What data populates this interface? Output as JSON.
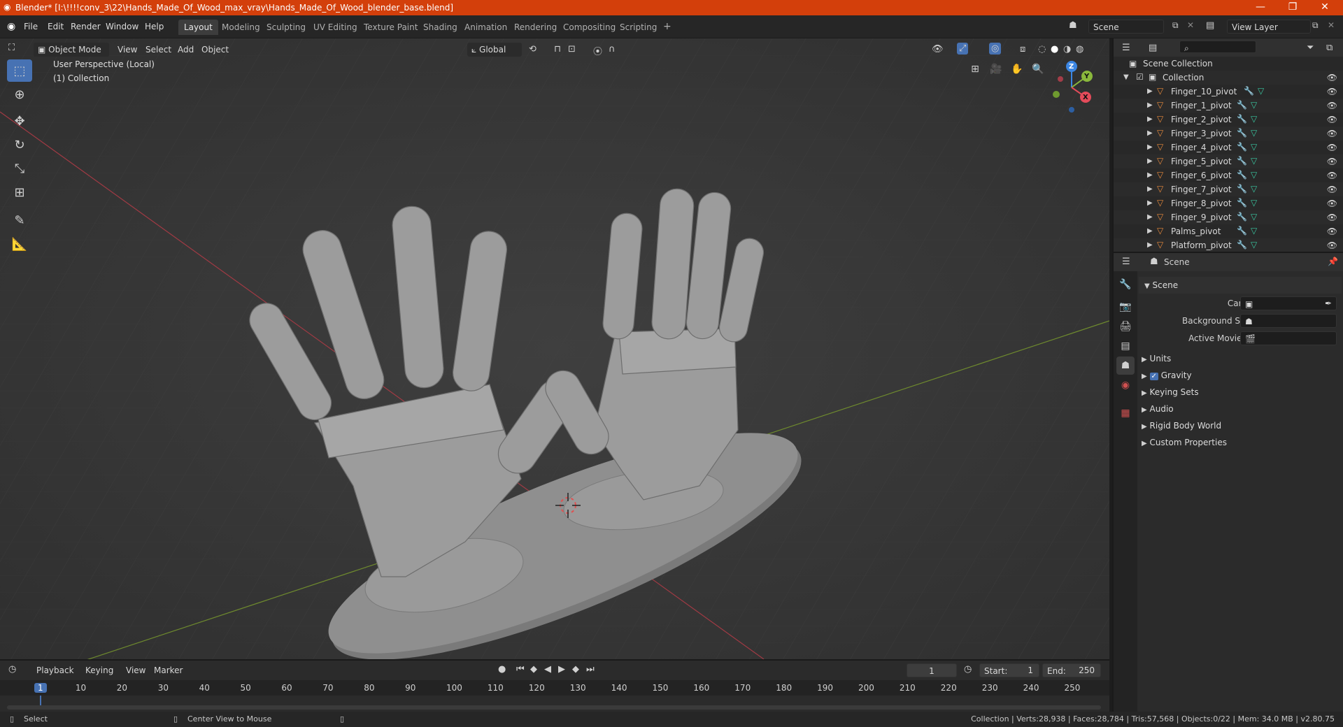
{
  "window": {
    "title": "Blender* [I:\\!!!!conv_3\\22\\Hands_Made_Of_Wood_max_vray\\Hands_Made_Of_Wood_blender_base.blend]",
    "minimize_icon": "minimize-icon",
    "maximize_icon": "restore-icon",
    "close_icon": "close-icon"
  },
  "topbar": {
    "menus": [
      "File",
      "Edit",
      "Render",
      "Window",
      "Help"
    ],
    "workspaces": [
      "Layout",
      "Modeling",
      "Sculpting",
      "UV Editing",
      "Texture Paint",
      "Shading",
      "Animation",
      "Rendering",
      "Compositing",
      "Scripting"
    ],
    "active_workspace": "Layout",
    "add_workspace": "+",
    "scene_value": "Scene",
    "view_layer_value": "View Layer"
  },
  "viewport": {
    "mode": "Object Mode",
    "menus": [
      "View",
      "Select",
      "Add",
      "Object"
    ],
    "transform_orientation": "Global",
    "overlay_line1": "User Perspective (Local)",
    "overlay_line2": "(1) Collection",
    "gizmo": {
      "x": "X",
      "y": "Y",
      "z": "Z"
    },
    "colors": {
      "x_axis": "#e34b5a",
      "y_axis": "#8ab83c",
      "z_axis": "#3b86e3",
      "background": "#393939"
    }
  },
  "outliner": {
    "root": "Scene Collection",
    "collection": "Collection",
    "items": [
      "Finger_10_pivot",
      "Finger_1_pivot",
      "Finger_2_pivot",
      "Finger_3_pivot",
      "Finger_4_pivot",
      "Finger_5_pivot",
      "Finger_6_pivot",
      "Finger_7_pivot",
      "Finger_8_pivot",
      "Finger_9_pivot",
      "Palms_pivot",
      "Platform_pivot"
    ]
  },
  "properties": {
    "header": "Scene",
    "panel_title": "Scene",
    "camera_label": "Camera",
    "background_scene_label": "Background Scene",
    "active_movie_clip_label": "Active Movie Clip",
    "subpanels": [
      "Units",
      "Gravity",
      "Keying Sets",
      "Audio",
      "Rigid Body World",
      "Custom Properties"
    ],
    "gravity_checked": true
  },
  "timeline": {
    "menus": [
      "Playback",
      "Keying",
      "View",
      "Marker"
    ],
    "current_frame": "1",
    "start_label": "Start:",
    "start_value": "1",
    "end_label": "End:",
    "end_value": "250",
    "ruler": [
      "1",
      "10",
      "20",
      "30",
      "40",
      "50",
      "60",
      "70",
      "80",
      "90",
      "100",
      "110",
      "120",
      "130",
      "140",
      "150",
      "160",
      "170",
      "180",
      "190",
      "200",
      "210",
      "220",
      "230",
      "240",
      "250"
    ]
  },
  "statusbar": {
    "left_hint": "Select",
    "middle_hint": "Center View to Mouse",
    "stats": "Collection | Verts:28,938 | Faces:28,784 | Tris:57,568 | Objects:0/22 | Mem: 34.0 MB | v2.80.75"
  }
}
